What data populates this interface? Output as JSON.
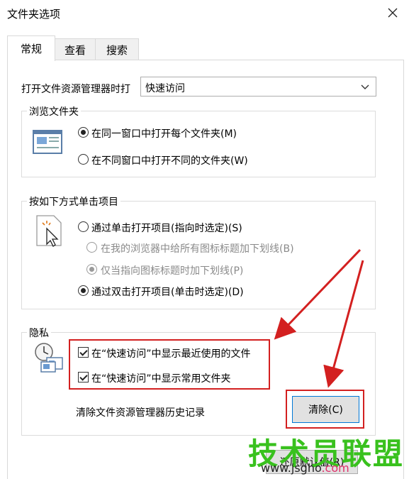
{
  "window": {
    "title": "文件夹选项"
  },
  "tabs": [
    {
      "label": "常规",
      "active": true
    },
    {
      "label": "查看",
      "active": false
    },
    {
      "label": "搜索",
      "active": false
    }
  ],
  "general": {
    "open_explorer_label": "打开文件资源管理器时打",
    "open_explorer_value": "快速访问",
    "browse": {
      "title": "浏览文件夹",
      "options": [
        {
          "label": "在同一窗口中打开每个文件夹(M)",
          "selected": true
        },
        {
          "label": "在不同窗口中打开不同的文件夹(W)",
          "selected": false
        }
      ]
    },
    "click": {
      "title": "按如下方式单击项目",
      "single": "通过单击打开项目(指向时选定)(S)",
      "underline_always": "在我的浏览器中给所有图标标题加下划线(B)",
      "underline_hover": "仅当指向图标标题时加下划线(P)",
      "double": "通过双击打开项目(单击时选定)(D)"
    },
    "privacy": {
      "title": "隐私",
      "recent_files": "在“快速访问”中显示最近使用的文件",
      "frequent_folders": "在“快速访问”中显示常用文件夹",
      "clear_label": "清除文件资源管理器历史记录",
      "clear_button": "清除(C)"
    },
    "restore_button": "还原默认值(R)"
  },
  "watermark": {
    "title": "技术员联盟",
    "url_main": "www.jsgho",
    "url_tld": ".com"
  },
  "colors": {
    "annotation_red": "#d32020",
    "watermark_green": "#39c11e",
    "watermark_pink": "#e0306a"
  }
}
